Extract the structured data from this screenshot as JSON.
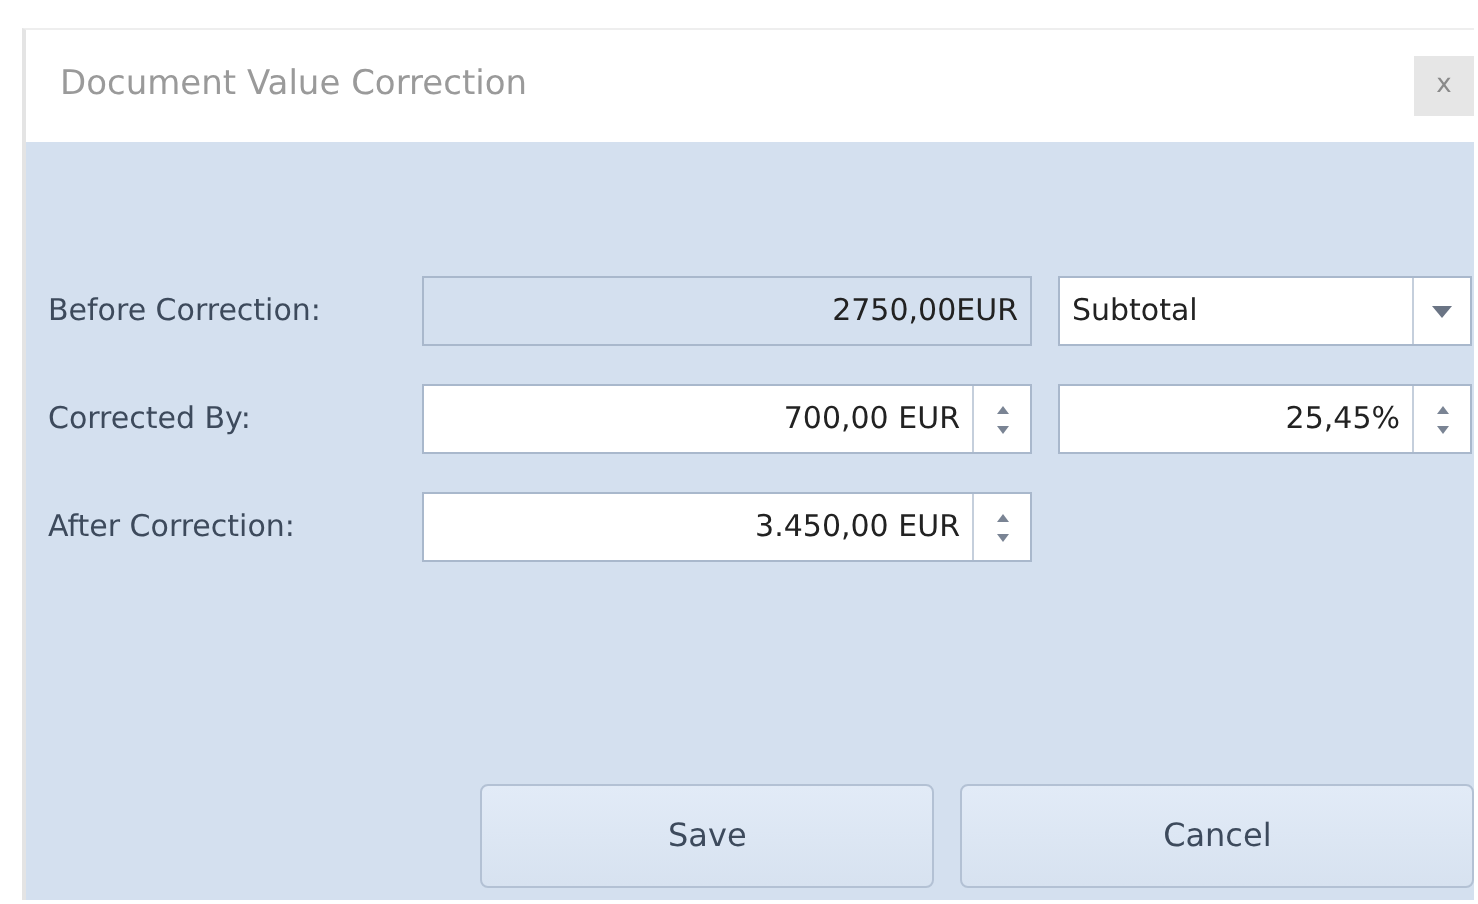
{
  "window": {
    "title": "Document Value Correction",
    "close": "x"
  },
  "rows": [
    {
      "label": "Before Correction:",
      "fields": [
        {
          "kind": "readonly",
          "value": "2750,00EUR"
        },
        {
          "kind": "dropdown",
          "value": "Subtotal"
        }
      ]
    },
    {
      "label": "Corrected By:",
      "fields": [
        {
          "kind": "spin",
          "value": "700,00 EUR"
        },
        {
          "kind": "spin",
          "value": "25,45%"
        }
      ]
    },
    {
      "label": "After Correction:",
      "fields": [
        {
          "kind": "spin",
          "value": "3.450,00 EUR"
        }
      ]
    }
  ],
  "buttons": [
    "Save",
    "Cancel"
  ]
}
